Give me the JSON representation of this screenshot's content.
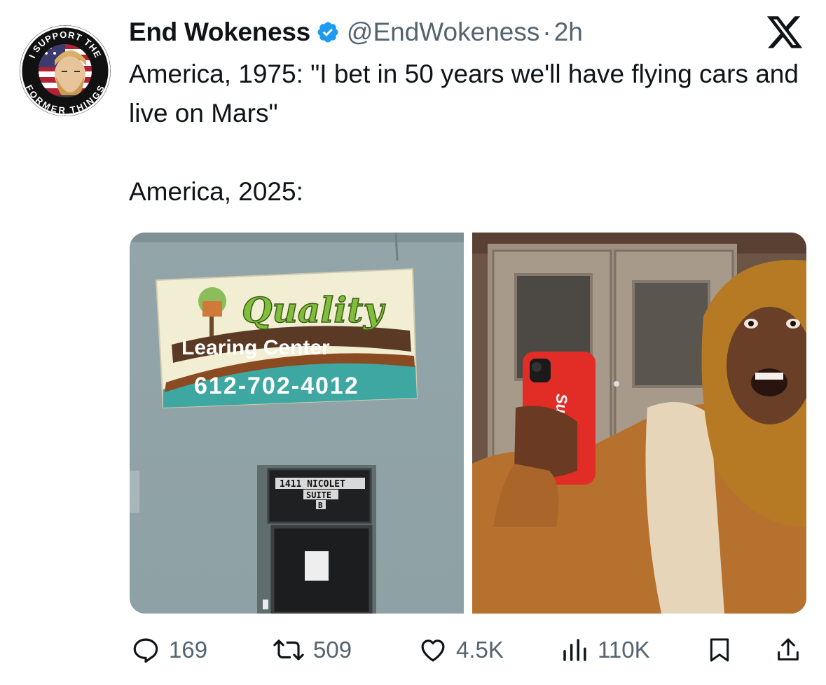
{
  "author": {
    "name": "End Wokeness",
    "handle": "@EndWokeness",
    "separator": "·",
    "time": "2h",
    "avatar_text_top": "I SUPPORT THE",
    "avatar_text_bottom": "FORMER THINGS"
  },
  "tweet": {
    "text": "America, 1975: \"I bet in 50 years we'll have flying cars and live on Mars\"\n\nAmerica, 2025:"
  },
  "media": {
    "sign": {
      "title": "Quality",
      "subtitle": "Learing Center",
      "phone": "612-702-4012"
    },
    "door_sign": {
      "line1": "1411 NICOLET",
      "line2": "SUITE",
      "line3": "B"
    },
    "phone_case_text": "Supr"
  },
  "actions": {
    "replies": "169",
    "reposts": "509",
    "likes": "4.5K",
    "views": "110K"
  },
  "icons": {
    "verified": "verified-badge-icon",
    "platform": "x-logo-icon",
    "reply": "reply-icon",
    "repost": "repost-icon",
    "like": "heart-icon",
    "views": "views-icon",
    "bookmark": "bookmark-icon",
    "share": "share-icon"
  },
  "colors": {
    "verified_blue": "#1d9bf0",
    "muted_text": "#536471",
    "text": "#0f1419"
  }
}
